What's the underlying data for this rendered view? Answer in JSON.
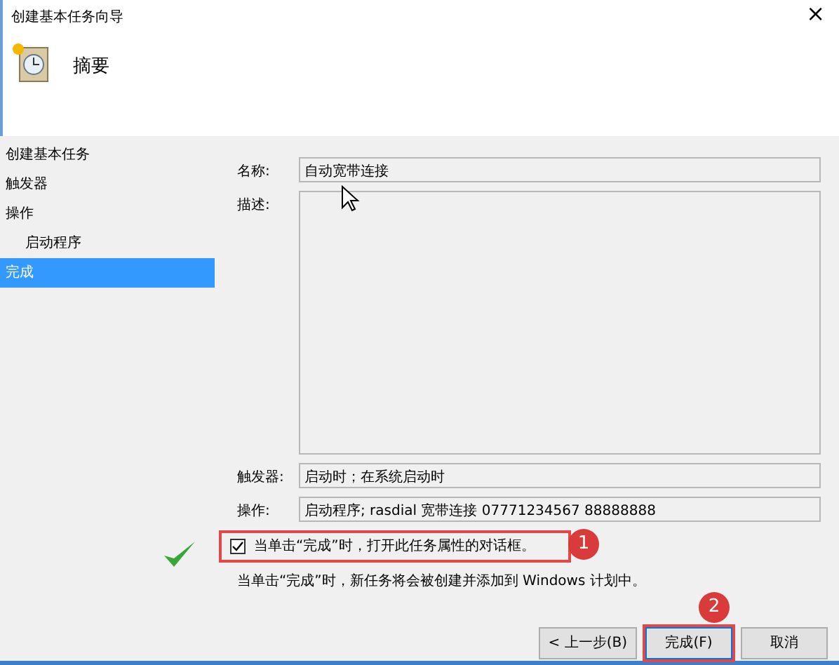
{
  "window": {
    "title": "创建基本任务向导",
    "close": "×"
  },
  "header": {
    "title": "摘要"
  },
  "sidebar": {
    "items": [
      {
        "label": "创建基本任务",
        "selected": false
      },
      {
        "label": "触发器",
        "selected": false
      },
      {
        "label": "操作",
        "selected": false,
        "children": [
          {
            "label": "启动程序",
            "selected": false
          }
        ]
      },
      {
        "label": "完成",
        "selected": true
      }
    ]
  },
  "fields": [
    {
      "kind": "line",
      "label": "名称:",
      "value": "自动宽带连接"
    },
    {
      "kind": "area",
      "label": "描述:"
    },
    {
      "kind": "line",
      "label": "触发器:",
      "value": "启动时；在系统启动时"
    },
    {
      "kind": "line",
      "label": "操作:",
      "value": "启动程序; rasdial 宽带连接 07771234567  88888888"
    }
  ],
  "option": {
    "label": "当单击“完成”时，打开此任务属性的对话框。",
    "checked": true
  },
  "note": "当单击“完成”时，新任务将会被创建并添加到 Windows 计划中。",
  "buttons": [
    {
      "label": "< 上一步(B)",
      "highlighted": false
    },
    {
      "label": "完成(F)",
      "highlighted": true
    },
    {
      "label": "取消",
      "highlighted": false
    }
  ],
  "annotations": [
    {
      "label": "1"
    },
    {
      "label": "2"
    }
  ]
}
